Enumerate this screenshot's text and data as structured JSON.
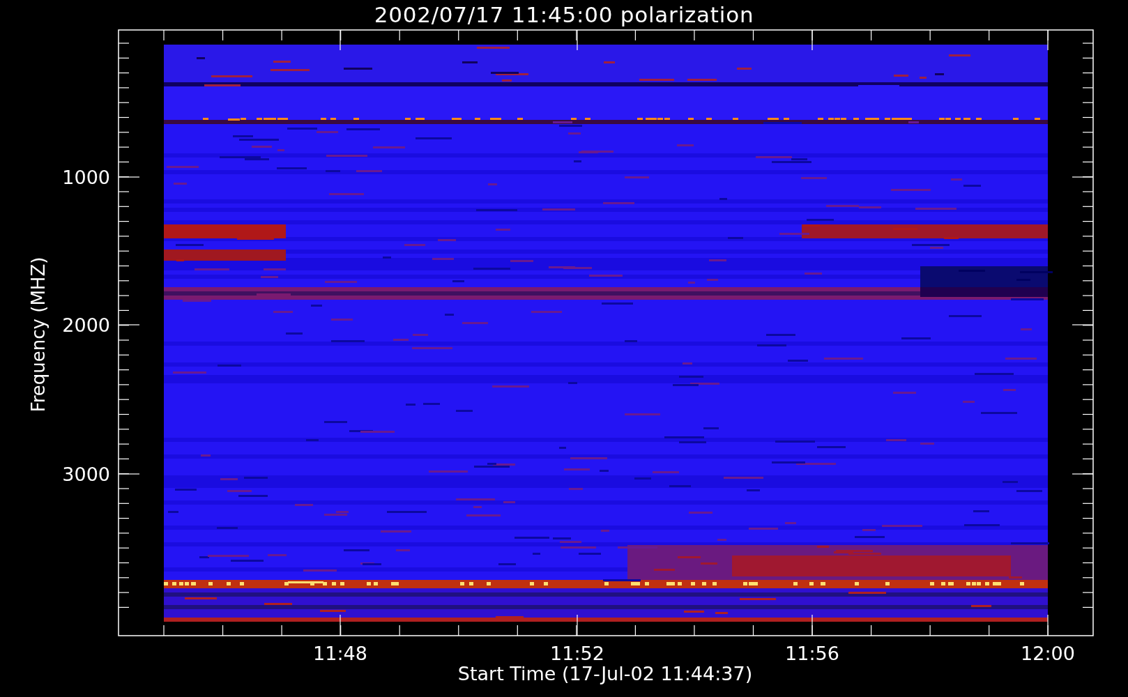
{
  "title": "2002/07/17 11:45:00 polarization",
  "y_axis": {
    "label": "Frequency (MHZ)",
    "ticks": [
      "1000",
      "2000",
      "3000"
    ]
  },
  "x_axis": {
    "label": "Start Time (17-Jul-02 11:44:37)",
    "ticks": [
      "11:48",
      "11:52",
      "11:56",
      "12:00"
    ]
  }
}
